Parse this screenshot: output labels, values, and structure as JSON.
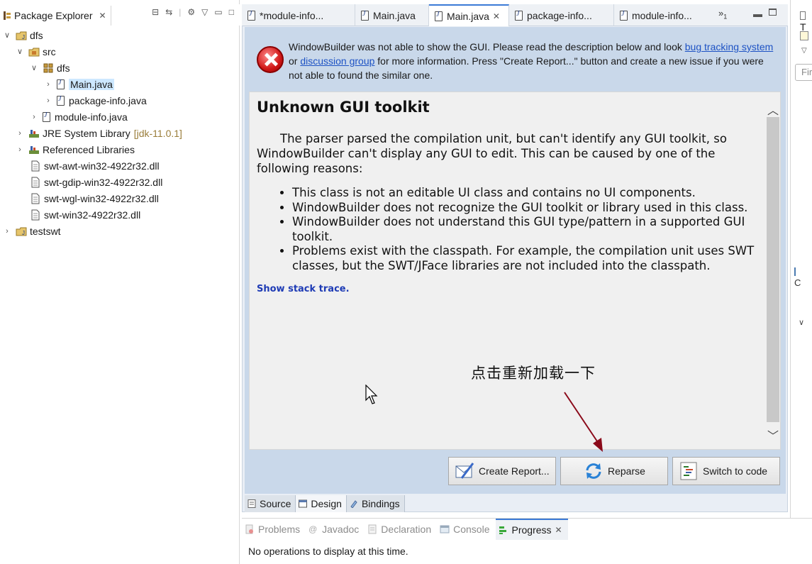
{
  "package_explorer": {
    "tab_label": "Package Explorer",
    "tree": [
      {
        "label": "dfs",
        "level": 0,
        "expanded": true,
        "icon": "project-icon"
      },
      {
        "label": "src",
        "level": 1,
        "expanded": true,
        "icon": "source-folder-icon"
      },
      {
        "label": "dfs",
        "level": 2,
        "expanded": true,
        "icon": "package-icon"
      },
      {
        "label": "Main.java",
        "level": 3,
        "expanded": false,
        "icon": "java-file-icon",
        "selected": true
      },
      {
        "label": "package-info.java",
        "level": 3,
        "expanded": false,
        "icon": "java-file-icon"
      },
      {
        "label": "module-info.java",
        "level": 2,
        "expanded": false,
        "icon": "java-file-icon"
      },
      {
        "label": "JRE System Library",
        "note": "[jdk-11.0.1]",
        "level": 1,
        "expanded": false,
        "icon": "library-icon"
      },
      {
        "label": "Referenced Libraries",
        "level": 1,
        "expanded": false,
        "icon": "library-icon"
      },
      {
        "label": "swt-awt-win32-4922r32.dll",
        "level": 1,
        "icon": "file-icon"
      },
      {
        "label": "swt-gdip-win32-4922r32.dll",
        "level": 1,
        "icon": "file-icon"
      },
      {
        "label": "swt-wgl-win32-4922r32.dll",
        "level": 1,
        "icon": "file-icon"
      },
      {
        "label": "swt-win32-4922r32.dll",
        "level": 1,
        "icon": "file-icon"
      },
      {
        "label": "testswt",
        "level": 0,
        "expanded": false,
        "icon": "project-icon"
      }
    ]
  },
  "editor": {
    "tabs": [
      {
        "label": "*module-info...",
        "active": false
      },
      {
        "label": "Main.java",
        "active": false
      },
      {
        "label": "Main.java",
        "active": true
      },
      {
        "label": "package-info...",
        "active": false
      },
      {
        "label": "module-info...",
        "active": false
      }
    ],
    "overflow_count": "1",
    "error": {
      "text_1": "WindowBuilder was not able to show the GUI. Please read the description below and look ",
      "link_1": "bug tracking system",
      "text_2": " or ",
      "link_2": "discussion group",
      "text_3": " for more information. Press \"Create Report...\" button and create a new issue if you were not able to found the similar one."
    },
    "content": {
      "title": "Unknown GUI toolkit",
      "paragraph": "The parser parsed the compilation unit, but can't identify any GUI toolkit, so WindowBuilder can't display any GUI to edit. This can be caused by one of the following reasons:",
      "reasons": [
        "This class is not an editable UI class and contains no UI components.",
        "WindowBuilder does not recognize the GUI toolkit or library used in this class.",
        "WindowBuilder does not understand this GUI type/pattern in a supported GUI toolkit.",
        "Problems exist with the classpath. For example, the compilation unit uses SWT classes, but the SWT/JFace libraries are not included into the classpath."
      ],
      "stack_trace_link": "Show stack trace."
    },
    "annotation": "点击重新加载一下",
    "buttons": {
      "create_report": "Create Report...",
      "reparse": "Reparse",
      "switch_to_code": "Switch to code"
    },
    "bottom_tabs": [
      "Source",
      "Design",
      "Bindings"
    ]
  },
  "bottom_panel": {
    "tabs": [
      "Problems",
      "Javadoc",
      "Declaration",
      "Console",
      "Progress"
    ],
    "active_tab": "Progress",
    "message": "No operations to display at this time."
  },
  "right_strip": {
    "tab_letter": "T",
    "find_placeholder": "Fir",
    "outline_letter": "C"
  },
  "colors": {
    "accent": "#3b7ad6",
    "error_red": "#d01818",
    "link_blue": "#1d52c4",
    "arrow_red": "#8b0a1a"
  }
}
